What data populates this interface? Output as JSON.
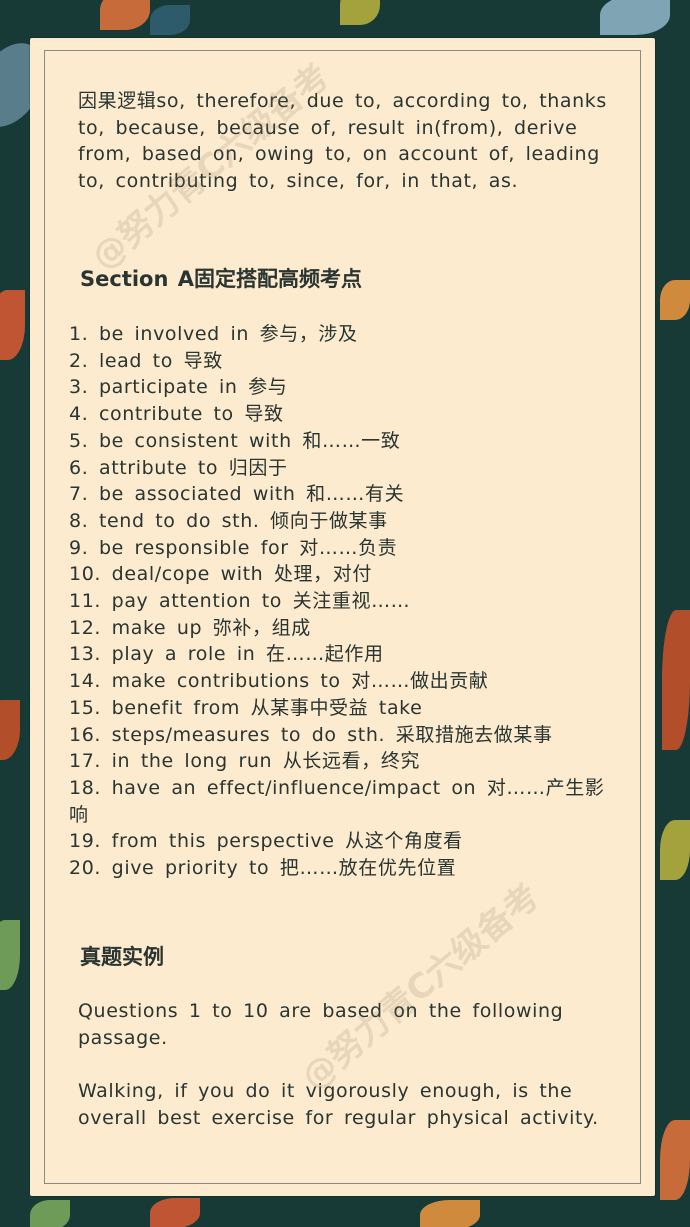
{
  "intro_text": "因果逻辑so, therefore, due to, according to, thanks to, because, because of, result in(from), derive from, based on, owing to, on account of, leading to, contributing to, since, for, in that, as.",
  "section_heading": "Section A固定搭配高频考点",
  "items": [
    "1. be involved in 参与，涉及",
    "2. lead to 导致",
    "3. participate in 参与",
    "4. contribute to 导致",
    "5. be consistent with 和……一致",
    "6. attribute to 归因于",
    "7. be associated with 和……有关",
    "8. tend to do sth. 倾向于做某事",
    "9. be responsible for 对……负责",
    "10. deal/cope with 处理，对付",
    "11. pay attention to 关注重视……",
    "12. make up 弥补，组成",
    "13. play a role in 在……起作用",
    "14. make contributions to 对……做出贡献",
    "15. benefit from 从某事中受益 take",
    "16. steps/measures to do sth. 采取措施去做某事",
    "17. in the long run 从长远看，终究",
    "18. have an effect/influence/impact on 对……产生影响",
    "19. from this perspective 从这个角度看",
    "20. give priority to 把……放在优先位置"
  ],
  "real_heading": "真题实例",
  "question_intro": "Questions 1 to 10 are based on the following passage.",
  "passage": "Walking, if you do it vigorously enough, is the overall best exercise for regular physical activity.",
  "watermark": "@努力青C六级备考",
  "colors": {
    "background": "#183a36",
    "card": "#fcebcf",
    "text": "#2a3431"
  }
}
